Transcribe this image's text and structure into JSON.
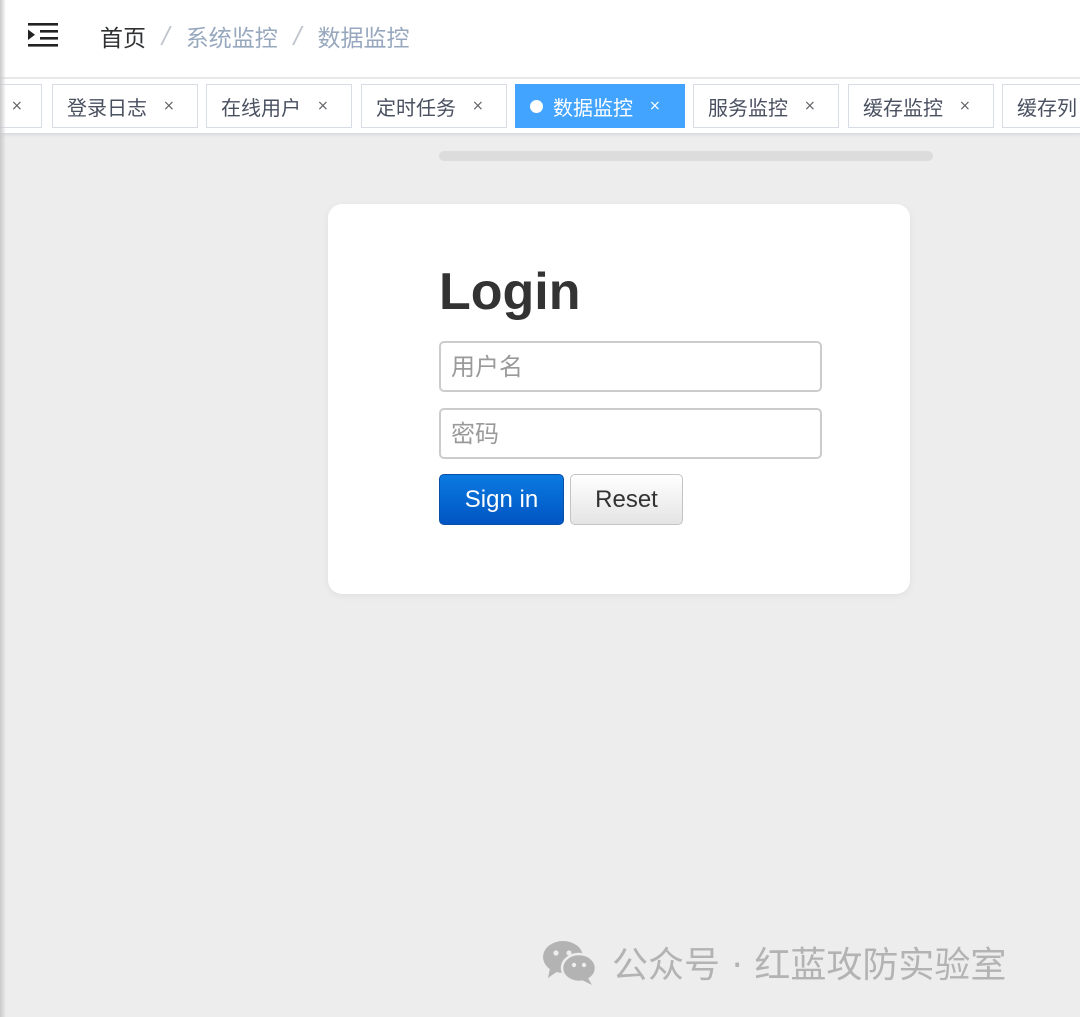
{
  "breadcrumb": {
    "home": "首页",
    "level1": "系统监控",
    "level2": "数据监控",
    "separator": "/"
  },
  "tags": [
    {
      "label": "",
      "active": false
    },
    {
      "label": "登录日志",
      "active": false
    },
    {
      "label": "在线用户",
      "active": false
    },
    {
      "label": "定时任务",
      "active": false
    },
    {
      "label": "数据监控",
      "active": true
    },
    {
      "label": "服务监控",
      "active": false
    },
    {
      "label": "缓存监控",
      "active": false
    },
    {
      "label": "缓存列",
      "active": false
    }
  ],
  "tag_close_glyph": "×",
  "login": {
    "title": "Login",
    "username_placeholder": "用户名",
    "password_placeholder": "密码",
    "signin_label": "Sign in",
    "reset_label": "Reset"
  },
  "watermark": {
    "text": "公众号 · 红蓝攻防实验室",
    "icon": "wechat-icon"
  },
  "colors": {
    "active_tag": "#42a4ff",
    "signin_button": "#0a6ad6",
    "background": "#ededed"
  }
}
